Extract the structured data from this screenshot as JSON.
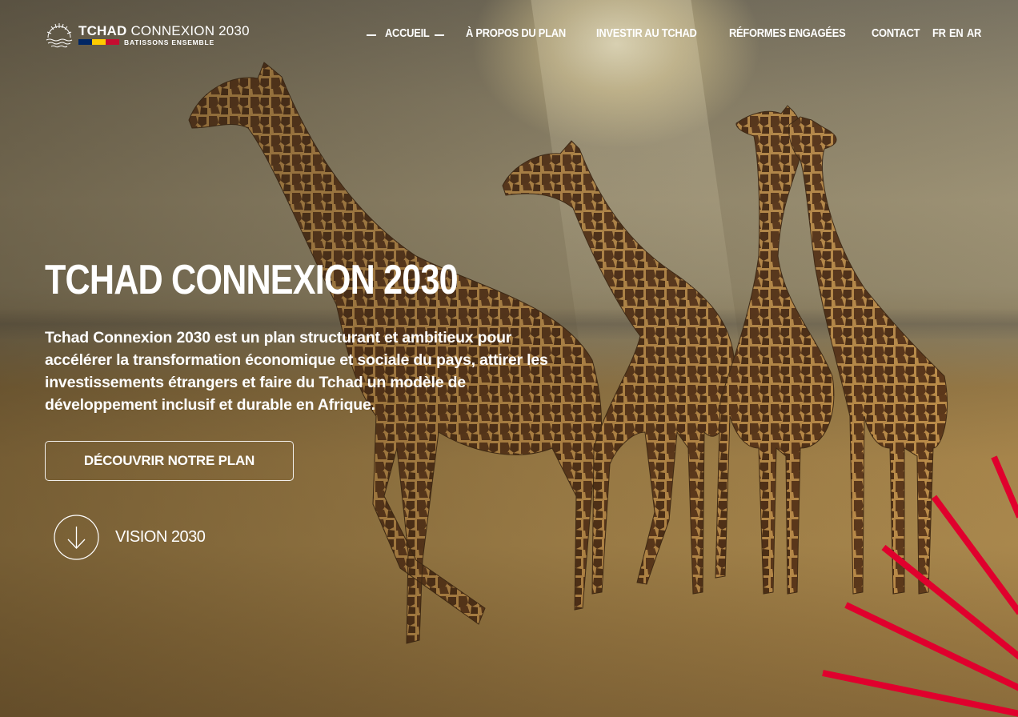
{
  "header": {
    "logo": {
      "brand_bold": "TCHAD",
      "brand_light": "CONNEXION 2030",
      "tagline": "BATISSONS ENSEMBLE",
      "icon": "sunrise-logo-icon",
      "flag_colors": [
        "#002664",
        "#FECB00",
        "#C60C30"
      ]
    },
    "nav": {
      "items": [
        {
          "label": "ACCUEIL",
          "active": true
        },
        {
          "label": "À PROPOS DU PLAN"
        },
        {
          "label": "INVESTIR AU TCHAD"
        },
        {
          "label": "RÉFORMES ENGAGÉES"
        },
        {
          "label": "CONTACT"
        }
      ],
      "languages": [
        "FR",
        "EN",
        "AR"
      ]
    }
  },
  "hero": {
    "title": "TCHAD CONNEXION 2030",
    "description": "Tchad Connexion 2030 est un plan structurant et ambitieux pour accélérer la transformation économique et sociale du pays, attirer les investissements étrangers et faire du Tchad un modèle de développement inclusif et durable en Afrique.",
    "cta_label": "DÉCOUVRIR NOTRE PLAN",
    "scroll_label": "VISION 2030",
    "scroll_icon": "arrow-down-icon",
    "background": "giraffes-savanna-photo"
  },
  "colors": {
    "accent_red": "#E0002D",
    "text": "#FFFFFF"
  }
}
